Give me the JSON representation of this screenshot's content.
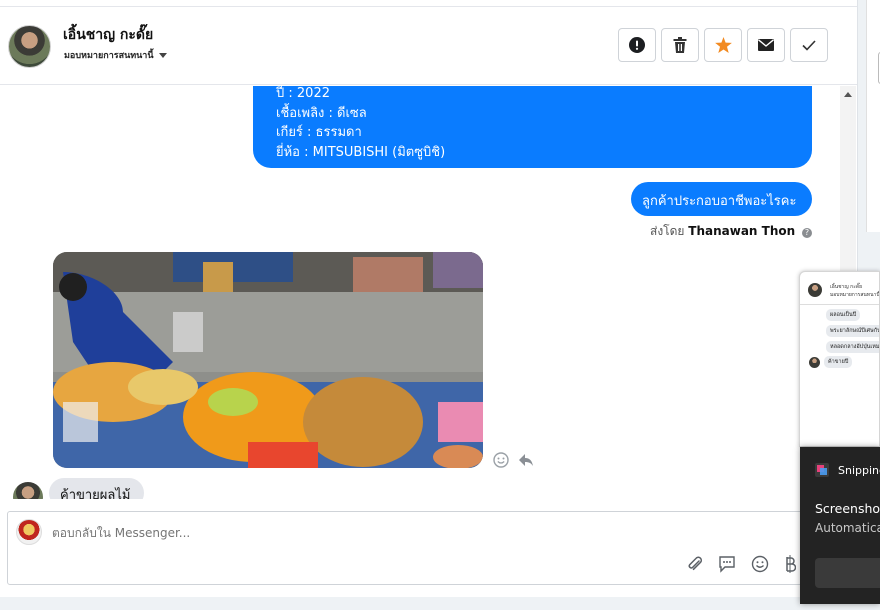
{
  "header": {
    "contact_name": "เอิ้นชาญ กะดั๊ย",
    "assign_label": "มอบหมายการสนทนานี้",
    "actions": [
      "report",
      "delete",
      "star",
      "mark-unread",
      "done"
    ]
  },
  "messages": {
    "info_lines": [
      "ปี : 2022",
      "เชื้อเพลิง : ดีเซล",
      "เกียร์ : ธรรมดา",
      "ยี่ห้อ : MITSUBISHI (มิตซูบิชิ)"
    ],
    "question": "ลูกค้าประกอบอาชีพอะไรคะ",
    "sent_by_prefix": "ส่งโดย",
    "sent_by_name": "Thanawan Thon",
    "help_glyph": "?",
    "customer_reply": "ค้าขายผลไม้"
  },
  "composer": {
    "placeholder": "ตอบกลับใน Messenger..."
  },
  "thumbnail": {
    "name": "เอิ้นชาญ กะดั๊ย",
    "sub": "มอบหมายการสนทนานี้",
    "bubbles": [
      "ผลอนเป็นปี",
      "พระยาลักษณ์ปีเศษกัน",
      "หลอดกลางอัปปุ่นเหม"
    ],
    "reply": "ค้าขายปี"
  },
  "toast": {
    "app_name": "Snipping Tool",
    "heading": "Screenshot copied to clipboard",
    "subtext": "Automatically saved to screenshots folder"
  },
  "colors": {
    "brand_blue": "#0a7cff",
    "star_orange": "#f28a21",
    "bubble_grey": "#e4e6eb"
  }
}
